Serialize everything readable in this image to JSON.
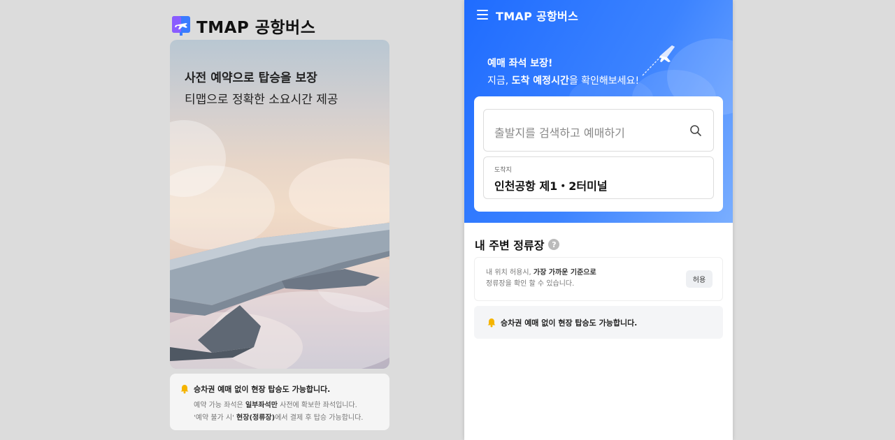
{
  "brand": {
    "name": "TMAP 공항버스"
  },
  "hero": {
    "title": "사전 예약으로 탑승을 보장",
    "subtitle": "티맵으로 정확한 소요시간 제공"
  },
  "left_notice": {
    "title": "승차권 예매 없이 현장 탑승도 가능합니다.",
    "line1_a": "예약 가능 좌석은 ",
    "line1_b": "일부좌석만",
    "line1_c": " 사전에 확보한 좌석입니다.",
    "line2_a": "'예약 불가 시' ",
    "line2_b": "현장(정류장)",
    "line2_c": "에서 결제 후 탑승 가능합니다."
  },
  "app": {
    "title": "TMAP 공항버스",
    "promo_line1": "예매 좌석 보장!",
    "promo_line2_a": "지금, ",
    "promo_line2_b": "도착 예정시간",
    "promo_line2_c": "을 확인해보세요!",
    "search": {
      "placeholder": "출발지를 검색하고 예매하기"
    },
    "destination": {
      "label": "도착지",
      "value": "인천공항 제1・2터미널"
    },
    "nearby": {
      "title": "내 주변 정류장",
      "help": "?",
      "text1_a": "내 위치 허용시, ",
      "text1_b": "가장 가까운 기준으로",
      "text2": "정류장을 확인 할 수 있습니다.",
      "allow_label": "허용"
    },
    "notice": "승차권 예매 없이 현장 탑승도 가능합니다."
  },
  "colors": {
    "accent": "#1f6cff",
    "bell": "#f5b400"
  }
}
